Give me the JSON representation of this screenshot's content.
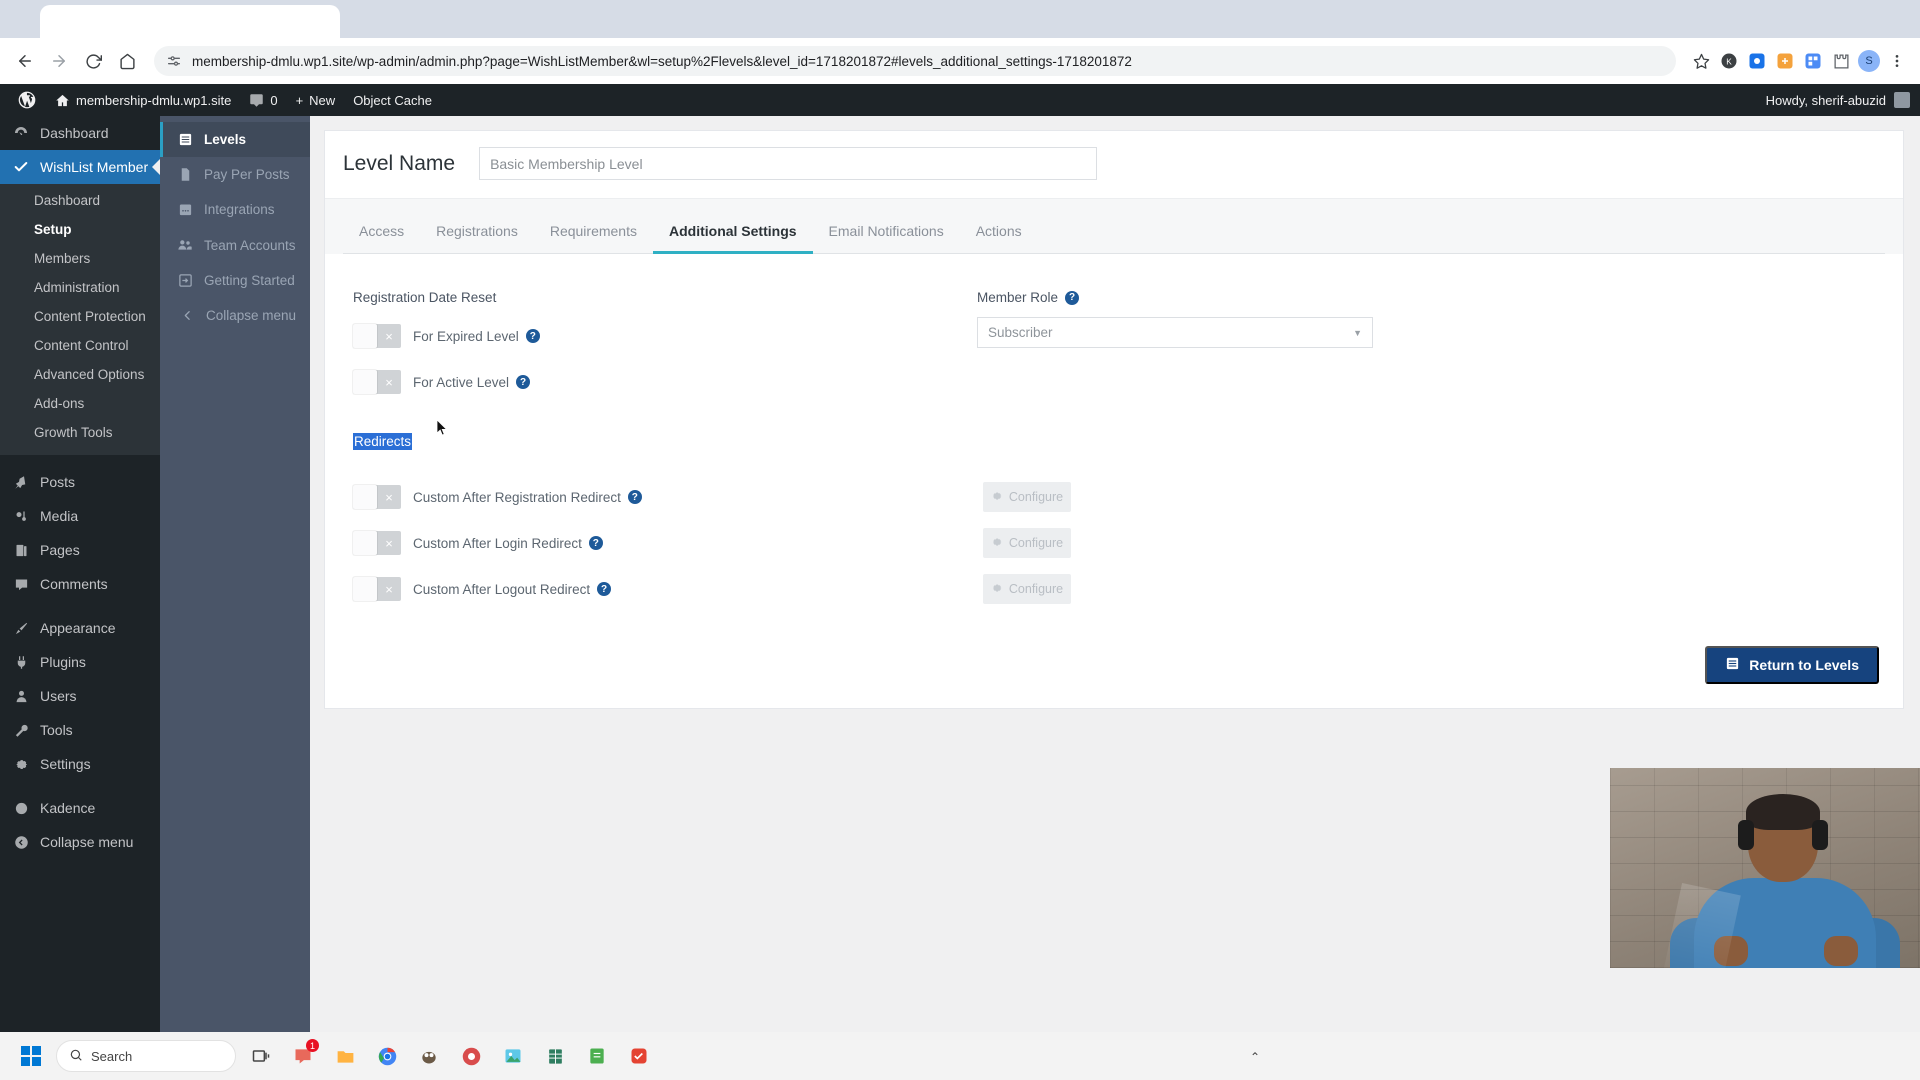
{
  "browser": {
    "url": "membership-dmlu.wp1.site/wp-admin/admin.php?page=WishListMember&wl=setup%2Flevels&level_id=1718201872#levels_additional_settings-1718201872",
    "back_icon": "back-arrow-icon",
    "forward_icon": "forward-arrow-icon",
    "reload_icon": "reload-icon",
    "home_icon": "home-icon",
    "site_info_icon": "site-settings-icon",
    "bookmark_icon": "star-icon",
    "menu_icon": "three-dot-menu-icon",
    "profile_initial": "S"
  },
  "adminbar": {
    "wp_logo": "wordpress-logo-icon",
    "site_name": "membership-dmlu.wp1.site",
    "comment_count": "0",
    "new_label": "New",
    "object_cache": "Object Cache",
    "howdy": "Howdy, sherif-abuzid"
  },
  "wp_menu": {
    "items": [
      {
        "label": "Dashboard",
        "icon": "dashboard-icon",
        "current": false
      },
      {
        "label": "WishList Member",
        "icon": "check-icon",
        "current": true
      }
    ],
    "wlm_sub": [
      {
        "label": "Dashboard",
        "active": false
      },
      {
        "label": "Setup",
        "active": true
      },
      {
        "label": "Members",
        "active": false
      },
      {
        "label": "Administration",
        "active": false
      },
      {
        "label": "Content Protection",
        "active": false
      },
      {
        "label": "Content Control",
        "active": false
      },
      {
        "label": "Advanced Options",
        "active": false
      },
      {
        "label": "Add-ons",
        "active": false
      },
      {
        "label": "Growth Tools",
        "active": false
      }
    ],
    "group2": [
      {
        "label": "Posts",
        "icon": "pin-icon"
      },
      {
        "label": "Media",
        "icon": "media-icon"
      },
      {
        "label": "Pages",
        "icon": "pages-icon"
      },
      {
        "label": "Comments",
        "icon": "comment-icon"
      }
    ],
    "group3": [
      {
        "label": "Appearance",
        "icon": "brush-icon"
      },
      {
        "label": "Plugins",
        "icon": "plug-icon"
      },
      {
        "label": "Users",
        "icon": "user-icon"
      },
      {
        "label": "Tools",
        "icon": "tools-icon"
      },
      {
        "label": "Settings",
        "icon": "settings-gear-icon"
      }
    ],
    "group4": [
      {
        "label": "Kadence",
        "icon": "kadence-icon"
      }
    ],
    "collapse": {
      "label": "Collapse menu",
      "icon": "collapse-circle-icon"
    }
  },
  "wlm_nav": {
    "items": [
      {
        "label": "Levels",
        "icon": "levels-list-icon",
        "active": true
      },
      {
        "label": "Pay Per Posts",
        "icon": "document-icon",
        "active": false
      },
      {
        "label": "Integrations",
        "icon": "calendar-icon",
        "active": false
      },
      {
        "label": "Team Accounts",
        "icon": "people-icon",
        "active": false
      },
      {
        "label": "Getting Started",
        "icon": "arrow-in-box-icon",
        "active": false
      }
    ],
    "collapse": {
      "label": "Collapse menu",
      "icon": "chevron-left-icon"
    }
  },
  "level": {
    "name_label": "Level Name",
    "name_value": "Basic Membership Level"
  },
  "tabs": [
    {
      "label": "Access",
      "active": false
    },
    {
      "label": "Registrations",
      "active": false
    },
    {
      "label": "Requirements",
      "active": false
    },
    {
      "label": "Additional Settings",
      "active": true
    },
    {
      "label": "Email Notifications",
      "active": false
    },
    {
      "label": "Actions",
      "active": false
    }
  ],
  "settings": {
    "registration_date_reset": {
      "label": "Registration Date Reset",
      "rows": [
        {
          "label": "For Expired Level",
          "enabled": false,
          "help": "help-icon"
        },
        {
          "label": "For Active Level",
          "enabled": false,
          "help": "help-icon"
        }
      ]
    },
    "redirects": {
      "label": "Redirects",
      "selected": true,
      "rows": [
        {
          "label": "Custom After Registration Redirect",
          "enabled": false,
          "button": "Configure"
        },
        {
          "label": "Custom After Login Redirect",
          "enabled": false,
          "button": "Configure"
        },
        {
          "label": "Custom After Logout Redirect",
          "enabled": false,
          "button": "Configure"
        }
      ]
    },
    "member_role": {
      "label": "Member Role",
      "value": "Subscriber",
      "help": "help-icon"
    },
    "toggle_off_glyph": "×"
  },
  "footer": {
    "return_button": "Return to Levels",
    "return_icon": "list-icon"
  },
  "taskbar": {
    "start": "windows-start-icon",
    "search_placeholder": "Search",
    "search_icon": "search-icon",
    "items": [
      {
        "name": "task-view-icon",
        "badge": null
      },
      {
        "name": "chat-icon",
        "badge": "1"
      },
      {
        "name": "file-explorer-icon",
        "badge": null
      },
      {
        "name": "chrome-icon",
        "badge": null
      },
      {
        "name": "gimp-icon",
        "badge": null
      },
      {
        "name": "obs-icon",
        "badge": null
      },
      {
        "name": "photos-icon",
        "badge": null
      },
      {
        "name": "spreadsheet-icon",
        "badge": null
      },
      {
        "name": "notepad-icon",
        "badge": null
      },
      {
        "name": "todoist-icon",
        "badge": null
      }
    ],
    "chevron": "chevron-up-icon"
  },
  "colors": {
    "wp_dark": "#1d2327",
    "wp_blue": "#2271b1",
    "wlm_nav": "#4a5568",
    "accent_teal": "#2fb0c4",
    "primary_button": "#16437e",
    "selection_blue": "#2b6fd6",
    "help_blue": "#1e5a99"
  }
}
